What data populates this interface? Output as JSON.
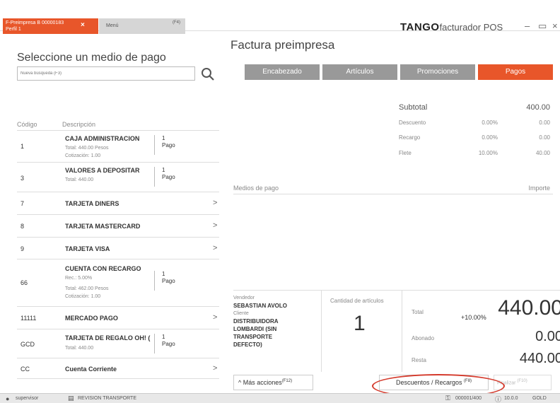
{
  "titlebar": {
    "active_tab_line1": "F-Preimpresa B 00000183",
    "active_tab_line2": "Perfil 1",
    "active_tab_close": "×",
    "menu_tab_label": "Menú",
    "menu_tab_key": "(F4)",
    "brand_bold": "TANGO",
    "brand_rest": "facturador POS",
    "minimize": "–",
    "maximize": "▭",
    "close": "×"
  },
  "left": {
    "title": "Seleccione un medio de pago",
    "search_placeholder": "Nueva búsqueda (F3)",
    "col_codigo": "Código",
    "col_descripcion": "Descripción",
    "rows": [
      {
        "code": "1",
        "desc": "CAJA ADMINISTRACION",
        "sub1": "Total:  440.00  Pesos",
        "sub2": "Cotización:  1.00",
        "pago_num": "1",
        "pago_lbl": "Pago"
      },
      {
        "code": "3",
        "desc": "VALORES A DEPOSITAR",
        "sub1": "Total:  440.00",
        "pago_num": "1",
        "pago_lbl": "Pago"
      },
      {
        "code": "7",
        "desc": "TARJETA DINERS",
        "chev": ">"
      },
      {
        "code": "8",
        "desc": "TARJETA MASTERCARD",
        "chev": ">"
      },
      {
        "code": "9",
        "desc": "TARJETA VISA",
        "chev": ">"
      },
      {
        "code": "66",
        "desc": "CUENTA CON RECARGO",
        "sub0": "Rec.: 5.00%",
        "sub1": "Total:  462.00  Pesos",
        "sub2": "Cotización:  1.00",
        "pago_num": "1",
        "pago_lbl": "Pago"
      },
      {
        "code": "11111",
        "desc": "MERCADO PAGO",
        "chev": ">"
      },
      {
        "code": "GCD",
        "desc": "TARJETA DE REGALO OH! (",
        "sub1": "Total:  440.00",
        "pago_num": "1",
        "pago_lbl": "Pago"
      },
      {
        "code": "CC",
        "desc": "Cuenta Corriente",
        "chev": ">"
      }
    ]
  },
  "right": {
    "title": "Factura preimpresa",
    "tabs": [
      "Encabezado",
      "Artículos",
      "Promociones",
      "Pagos"
    ],
    "subtotal_label": "Subtotal",
    "subtotal_value": "400.00",
    "lines": [
      {
        "label": "Descuento",
        "pct": "0.00%",
        "value": "0.00"
      },
      {
        "label": "Recargo",
        "pct": "0.00%",
        "value": "0.00"
      },
      {
        "label": "Flete",
        "pct": "10.00%",
        "value": "40.00"
      }
    ],
    "medios_label": "Medios de pago",
    "importe_label": "Importe",
    "vendedor_label": "Vendedor",
    "vendedor_value": "SEBASTIAN AVOLO",
    "cliente_label": "Cliente",
    "cliente_value_1": "DISTRIBUIDORA",
    "cliente_value_2": "LOMBARDI (SIN",
    "cliente_value_3": "TRANSPORTE",
    "cliente_value_4": "DEFECTO)",
    "cantidad_label": "Cantidad de artículos",
    "cantidad_value": "1",
    "total_label": "Total",
    "total_pct": "+10.00%",
    "total_value": "440.00",
    "abonado_label": "Abonado",
    "abonado_value": "0.00",
    "resta_label": "Resta",
    "resta_value": "440.00",
    "mas_acciones": "^  Más acciones",
    "mas_acciones_key": "(F12)",
    "descuentos_recargos": "Descuentos / Recargos",
    "descuentos_key": "(F8)",
    "finalizar": "Finalizar",
    "finalizar_key": "(F10)"
  },
  "status": {
    "user": "supervisor",
    "report": "REVISION TRANSPORTE",
    "counter": "000001/400",
    "version": "10.0.0",
    "edition": "GOLD"
  },
  "colors": {
    "accent": "#e8562a",
    "tab_gray": "#999999",
    "highlight": "#d43a2c"
  }
}
